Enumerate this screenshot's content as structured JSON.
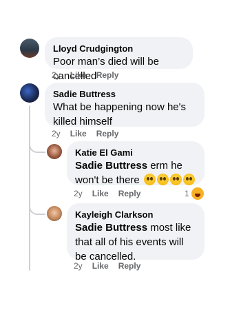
{
  "comments": [
    {
      "author": "Lloyd Crudgington",
      "text": "Poor man’s died will be cancelled",
      "time": "2y",
      "like": "Like",
      "reply": "Reply"
    },
    {
      "author": "Sadie Buttress",
      "text": "What be happening now he's killed himself",
      "time": "2y",
      "like": "Like",
      "reply": "Reply"
    }
  ],
  "replies": [
    {
      "author": "Katie El Gami",
      "tag": "Sadie Buttress",
      "text": " erm he won't be there",
      "emojis": [
        "flushed-face",
        "flushed-face",
        "flushed-face",
        "flushed-face"
      ],
      "time": "2y",
      "like": "Like",
      "reply": "Reply",
      "reaction_count": "1",
      "reaction_icon": "haha-reaction-icon"
    },
    {
      "author": "Kayleigh Clarkson",
      "tag": "Sadie Buttress",
      "text": " most like that all of his events will be cancelled.",
      "time": "2y",
      "like": "Like",
      "reply": "Reply"
    }
  ],
  "colors": {
    "bubble": "#f0f2f5",
    "meta": "#65676b",
    "line": "#ced0d4"
  }
}
